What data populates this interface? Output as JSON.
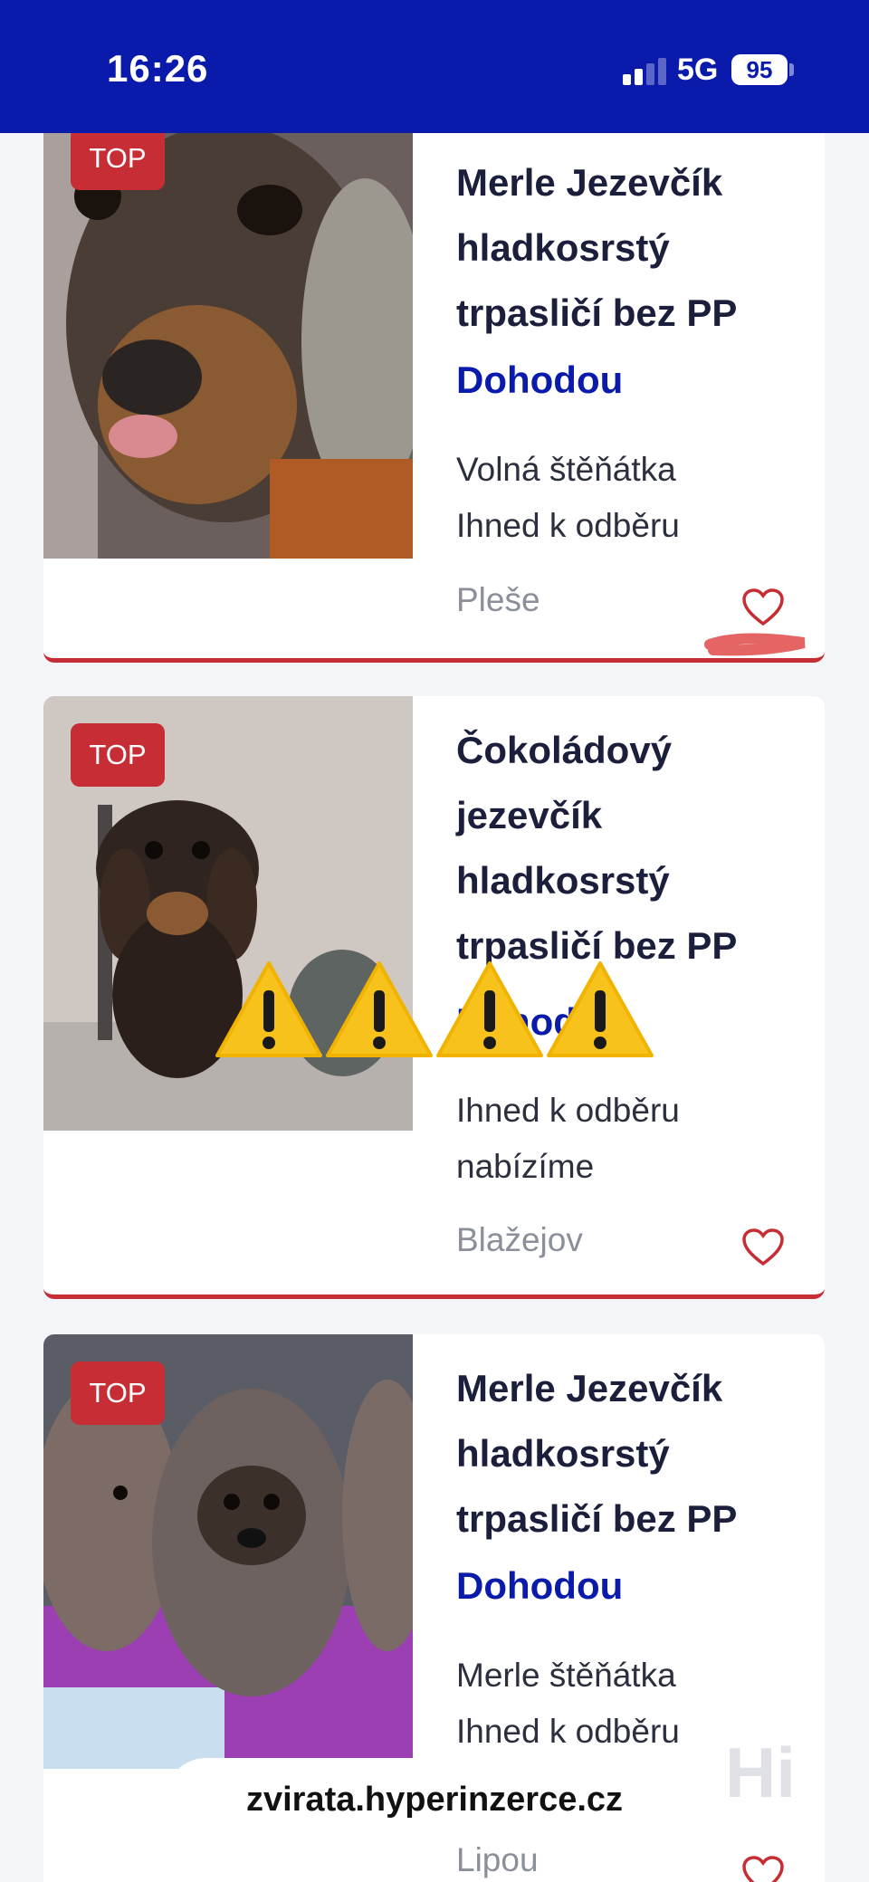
{
  "status_bar": {
    "time": "16:26",
    "network": "5G",
    "battery": "95"
  },
  "listings": [
    {
      "badge": "TOP",
      "title": [
        "Merle Jezevčík",
        "hladkosrstý",
        "trpasličí bez PP"
      ],
      "price": "Dohodou",
      "description": [
        "Volná štěňátka",
        "Ihned k odběru"
      ],
      "location": "Pleše"
    },
    {
      "badge": "TOP",
      "title": [
        "Čokoládový",
        "jezevčík",
        "hladkosrstý",
        "trpasličí bez PP"
      ],
      "price": "Dohodou",
      "description": [
        "Ihned k odběru",
        "nabízíme"
      ],
      "location": "Blažejov"
    },
    {
      "badge": "TOP",
      "title": [
        "Merle Jezevčík",
        "hladkosrstý",
        "trpasličí bez PP"
      ],
      "price": "Dohodou",
      "description": [
        "Merle štěňátka",
        "Ihned k odběru"
      ],
      "location": "Lipou"
    }
  ],
  "overlay": {
    "website": "zvirata.hyperinzerce.cz",
    "logo_text": "Hi"
  },
  "colors": {
    "brand_blue": "#0a1aab",
    "accent_red": "#c62d34",
    "warning_yellow": "#f7c21b"
  },
  "icons": {
    "favorite": "heart-outline-icon",
    "warning": "warning-sign-icon"
  }
}
